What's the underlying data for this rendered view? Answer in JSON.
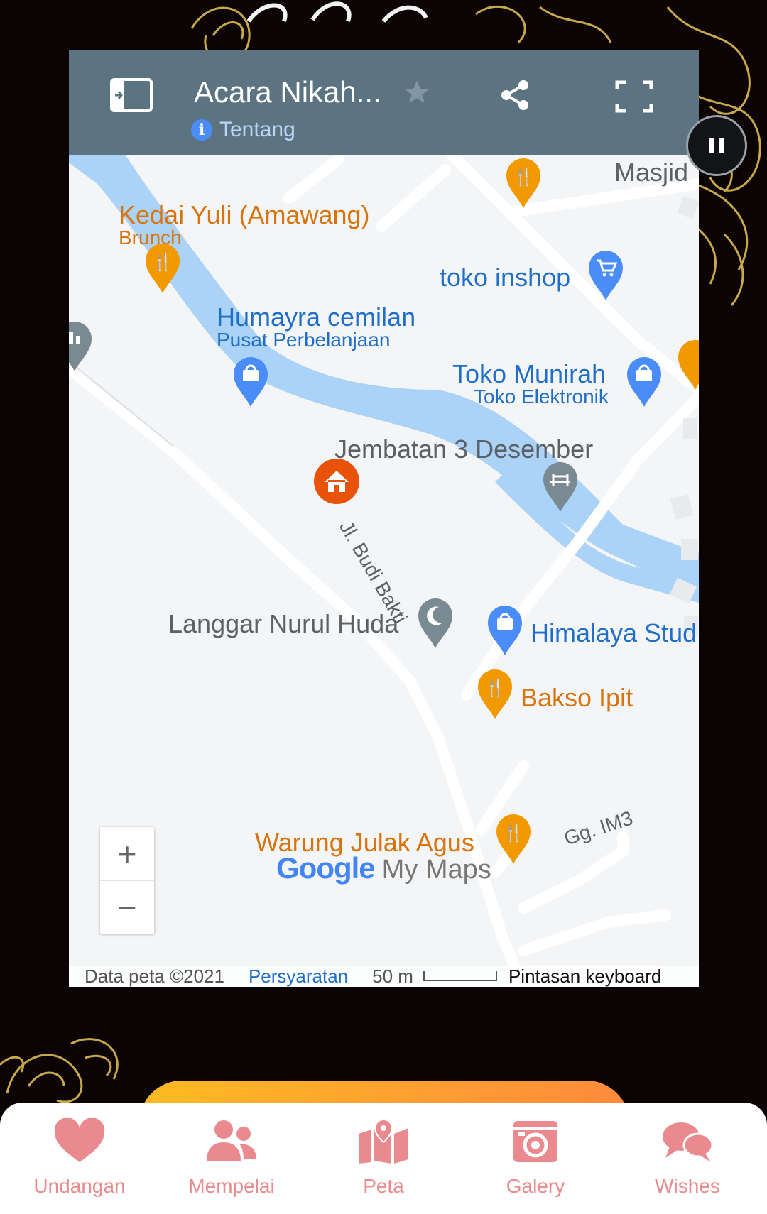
{
  "map": {
    "title": "Acara Nikah...",
    "about_label": "Tentang",
    "places": {
      "masjid": "Masjid",
      "kedai_yuli": "Kedai Yuli (Amawang)",
      "kedai_yuli_sub": "Brunch",
      "toko_inshop": "toko inshop",
      "humayra": "Humayra cemilan",
      "humayra_sub": "Pusat Perbelanjaan",
      "toko_munirah": "Toko Munirah",
      "toko_munirah_sub": "Toko Elektronik",
      "jembatan": "Jembatan 3 Desember",
      "jalan_budi": "Jl. Budi Bakti",
      "langgar": "Langgar Nurul Huda",
      "himalaya": "Himalaya Stud",
      "bakso": "Bakso Ipit",
      "warung": "Warung Julak Agus",
      "gang": "Gg. IM3"
    },
    "logo_google": "Google",
    "logo_mymaps": "My Maps",
    "footer": {
      "data_label": "Data peta ©2021",
      "terms": "Persyaratan",
      "scale": "50 m",
      "shortcuts": "Pintasan keyboard"
    },
    "zoom_in": "+",
    "zoom_out": "−"
  },
  "nav": {
    "items": [
      {
        "label": "Undangan",
        "icon": "heart-icon"
      },
      {
        "label": "Mempelai",
        "icon": "users-icon"
      },
      {
        "label": "Peta",
        "icon": "map-icon"
      },
      {
        "label": "Galery",
        "icon": "camera-icon"
      },
      {
        "label": "Wishes",
        "icon": "chat-icon"
      }
    ]
  },
  "colors": {
    "header_bg": "#5c7482",
    "accent_orange": "#f29900",
    "accent_blue": "#4a8df8",
    "nav_pink": "#ea8a8e",
    "background": "#0b0304"
  }
}
